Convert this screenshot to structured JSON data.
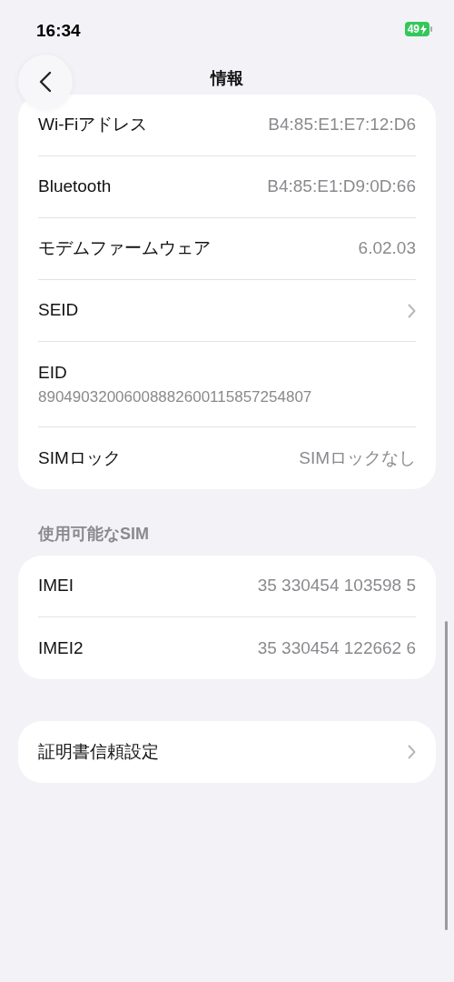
{
  "status_bar": {
    "time": "16:34",
    "battery": "49",
    "charging": true
  },
  "nav": {
    "title": "情報"
  },
  "groups": [
    {
      "rows": [
        {
          "kind": "value",
          "label": "Wi-Fiアドレス",
          "value": "B4:85:E1:E7:12:D6"
        },
        {
          "kind": "value",
          "label": "Bluetooth",
          "value": "B4:85:E1:D9:0D:66"
        },
        {
          "kind": "value",
          "label": "モデムファームウェア",
          "value": "6.02.03"
        },
        {
          "kind": "link",
          "label": "SEID"
        },
        {
          "kind": "stacked",
          "label": "EID",
          "value": "89049032006008882600115857254807"
        },
        {
          "kind": "value",
          "label": "SIMロック",
          "value": "SIMロックなし"
        }
      ]
    },
    {
      "header": "使用可能なSIM",
      "rows": [
        {
          "kind": "value",
          "label": "IMEI",
          "value": "35 330454 103598 5"
        },
        {
          "kind": "value",
          "label": "IMEI2",
          "value": "35 330454 122662 6"
        }
      ]
    },
    {
      "rows": [
        {
          "kind": "link",
          "label": "証明書信頼設定"
        }
      ]
    }
  ]
}
